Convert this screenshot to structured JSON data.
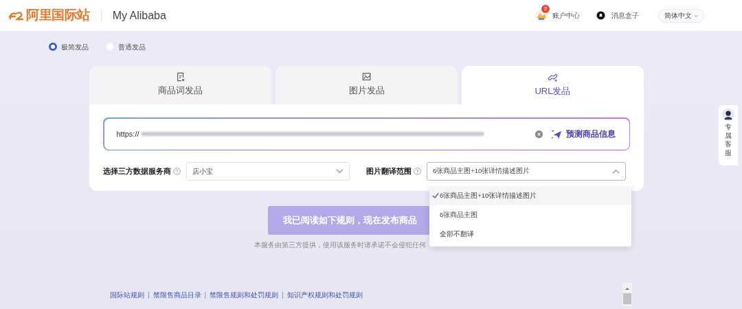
{
  "header": {
    "logo": "阿里国际站",
    "title": "My Alibaba",
    "account": {
      "label": "账户中心",
      "badge": "2"
    },
    "messages": {
      "label": "消息盒子"
    },
    "language": "简体中文"
  },
  "mode_options": [
    {
      "label": "极简发品",
      "selected": true
    },
    {
      "label": "普通发品",
      "selected": false
    }
  ],
  "tabs": [
    {
      "label": "商品词发品",
      "selected": false
    },
    {
      "label": "图片发品",
      "selected": false
    },
    {
      "label": "URL发品",
      "selected": true
    }
  ],
  "url_field": {
    "value": "https://"
  },
  "predict_button": "预测商品信息",
  "provider": {
    "label": "选择三方数据服务商",
    "value": "店小宝"
  },
  "translate_scope": {
    "label": "图片翻译范围",
    "value": "6张商品主图+10张详情描述图片",
    "expanded": true,
    "options": [
      {
        "label": "6张商品主图+10张详情描述图片",
        "selected": true
      },
      {
        "label": "6张商品主图",
        "selected": false
      },
      {
        "label": "全部不翻译",
        "selected": false
      }
    ]
  },
  "publish_button": "我已阅读如下规则，现在发布商品",
  "notice": "本服务由第三方提供，使用该服务时请承诺不会侵犯任何",
  "rule_links": [
    "国际站规则",
    "禁限售商品目录",
    "禁限售规则和处罚规则",
    "知识产权规则和处罚规则"
  ],
  "link_separator": "|",
  "side_widget": {
    "label": "专属客服"
  }
}
